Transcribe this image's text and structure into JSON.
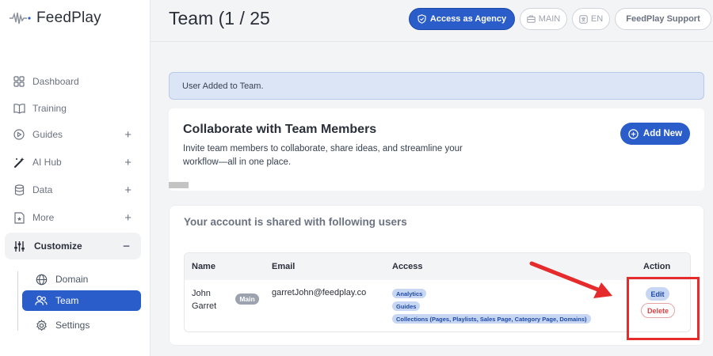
{
  "app": {
    "name": "FeedPlay",
    "brand_color": "#2a5dc9"
  },
  "sidebar": {
    "items": [
      {
        "label": "Dashboard",
        "icon": "grid-icon"
      },
      {
        "label": "Training",
        "icon": "book-icon"
      },
      {
        "label": "Guides",
        "icon": "play-circle-icon",
        "expand": "+"
      },
      {
        "label": "AI Hub",
        "icon": "magic-wand-icon",
        "expand": "+"
      },
      {
        "label": "Data",
        "icon": "database-icon",
        "expand": "+"
      },
      {
        "label": "More",
        "icon": "star-file-icon",
        "expand": "+"
      },
      {
        "label": "Customize",
        "icon": "sliders-icon",
        "expand": "−"
      }
    ],
    "subitems": [
      {
        "label": "Domain",
        "icon": "globe-icon"
      },
      {
        "label": "Team",
        "icon": "users-icon"
      },
      {
        "label": "Settings",
        "icon": "gear-icon"
      }
    ]
  },
  "header": {
    "title": "Team (1 / 25",
    "agency_label": "Access as Agency",
    "main_label": "MAIN",
    "lang_label": "EN",
    "support_label": "FeedPlay Support"
  },
  "alert": {
    "text": "User Added to Team."
  },
  "collab": {
    "title": "Collaborate with Team Members",
    "description": "Invite team members to collaborate, share ideas, and streamline your workflow—all in one place.",
    "add_label": "Add New"
  },
  "shared": {
    "title": "Your account is shared with following users",
    "columns": [
      "Name",
      "Email",
      "Access",
      "Action"
    ],
    "row": {
      "first_name": "John",
      "last_name": "Garret",
      "badge": "Main",
      "email": "garretJohn@feedplay.co",
      "access": [
        "Analytics",
        "Guides",
        "Collections (Pages, Playlists, Sales Page, Category Page, Domains)"
      ],
      "edit_label": "Edit",
      "delete_label": "Delete"
    }
  }
}
